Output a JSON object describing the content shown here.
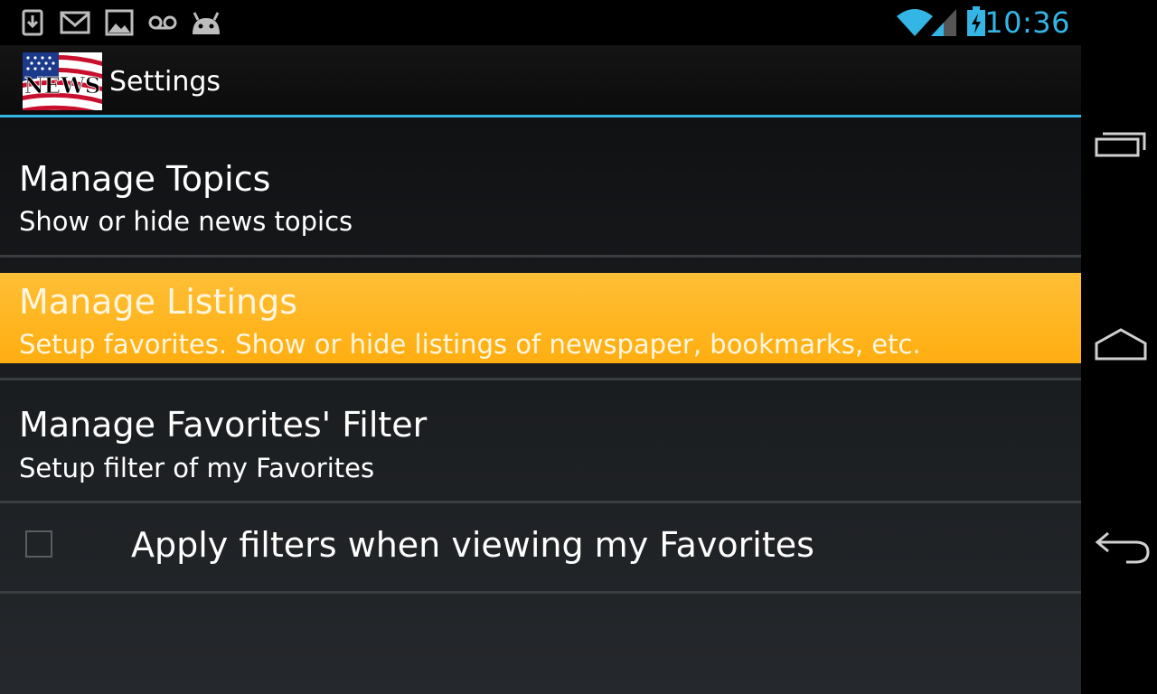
{
  "status_bar": {
    "time": "10:36",
    "icons": [
      "download-icon",
      "gmail-icon",
      "gallery-icon",
      "voicemail-icon",
      "android-icon",
      "wifi-icon",
      "signal-icon",
      "battery-charging-icon"
    ],
    "accent_color": "#33b5e5"
  },
  "action_bar": {
    "icon_text": "NEWS",
    "title": "Settings"
  },
  "preferences": [
    {
      "title": "Manage Topics",
      "summary": "Show or hide news topics"
    },
    {
      "title": "Manage Listings",
      "summary": "Setup favorites. Show or hide listings of newspaper, bookmarks, etc.",
      "highlight_color": "#ffb31f"
    },
    {
      "title": "Manage Favorites' Filter",
      "summary": "Setup filter of my Favorites"
    }
  ],
  "checkbox_pref": {
    "label": "Apply filters when viewing my Favorites",
    "checked": false
  },
  "nav_bar": {
    "buttons": [
      "recent-apps-icon",
      "home-icon",
      "back-icon"
    ]
  }
}
